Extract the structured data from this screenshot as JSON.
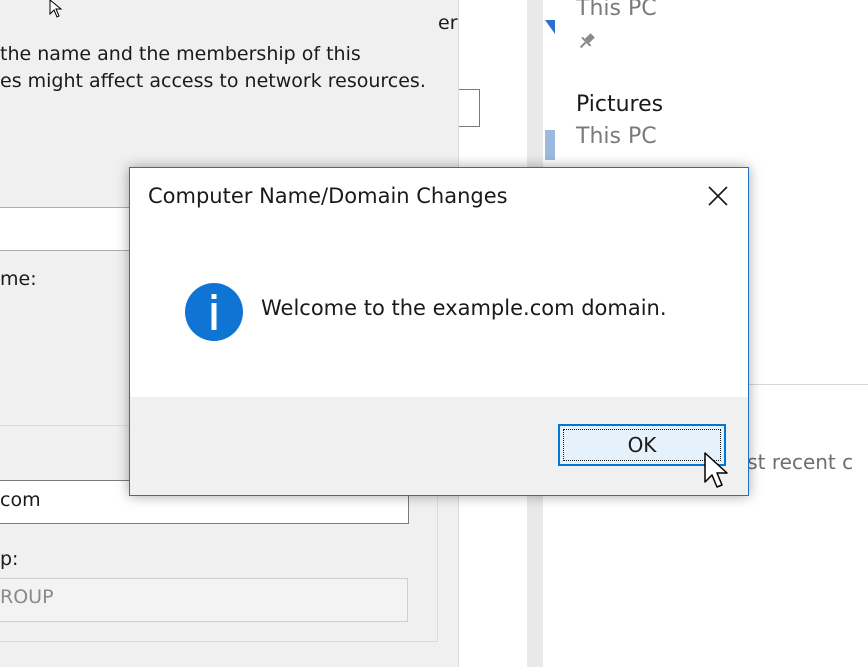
{
  "background_dialog": {
    "description_line1": "the name and the membership of this",
    "description_line2": "es might affect access to network resources.",
    "partial_right_text": "er",
    "name_label_partial": "me:",
    "domain_value_partial": "com",
    "workgroup_label_partial": "p:",
    "workgroup_value_partial": "ROUP"
  },
  "quick_access": {
    "items": [
      {
        "title": "",
        "location": "This PC"
      },
      {
        "title": "Pictures",
        "location": "This PC"
      }
    ],
    "recent_text_partial": "ost recent c"
  },
  "dialog": {
    "title": "Computer Name/Domain Changes",
    "message": "Welcome to the example.com domain.",
    "ok_label": "OK",
    "icon": "info-icon",
    "accent_color": "#0078d7"
  },
  "colors": {
    "info_blue": "#1074d4",
    "window_border": "#1e73c8"
  }
}
